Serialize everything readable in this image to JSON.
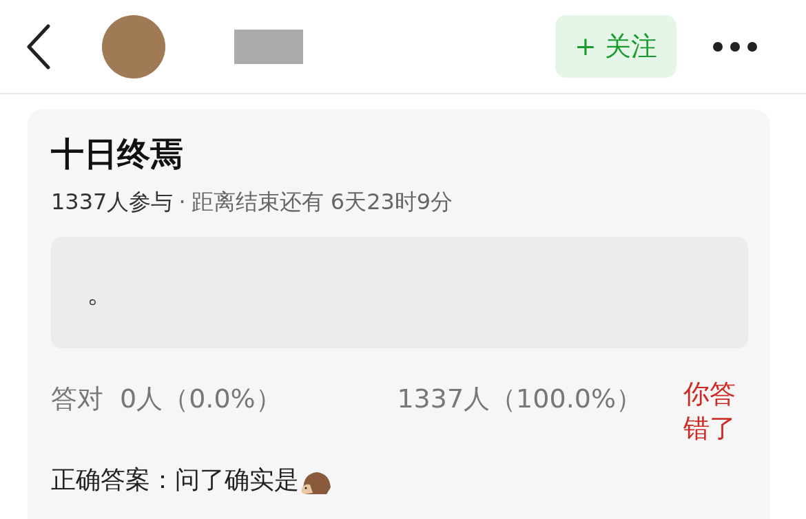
{
  "header": {
    "follow_button": "+ 关注"
  },
  "poll": {
    "title": "十日终焉",
    "participants": "1337人参与",
    "separator": "·",
    "deadline": "距离结束还有 6天23时9分",
    "option": {
      "text": "。"
    },
    "results": {
      "correct_label": "答对",
      "correct_count": "0人（0.0%）",
      "total": "1337人（100.0%）",
      "verdict": "你答错了"
    },
    "answer": {
      "label": "正确答案：",
      "text": "问了确实是"
    }
  }
}
